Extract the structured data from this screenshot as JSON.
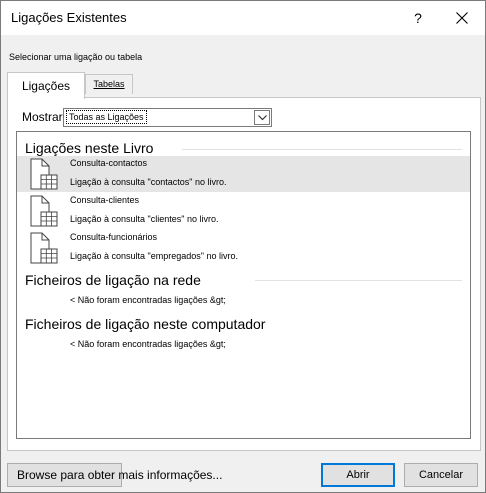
{
  "window": {
    "title": "Ligações Existentes",
    "help_label": "?"
  },
  "subtitle": "Selecionar uma ligação ou tabela",
  "tabs": [
    {
      "label": "Ligações",
      "active": true
    },
    {
      "label": "Tabelas",
      "active": false
    }
  ],
  "show": {
    "label": "Mostrar",
    "selected": "Todas as Ligações"
  },
  "sections": [
    {
      "header": "Ligações neste Livro",
      "items": [
        {
          "name": "Consulta-contactos",
          "description": "Ligação à consulta \"contactos\" no livro.",
          "selected": true
        },
        {
          "name": "Consulta-clientes",
          "description": "Ligação à consulta \"clientes\" no livro.",
          "selected": false
        },
        {
          "name": "Consulta-funcionários",
          "description": "Ligação à consulta \"empregados\" no livro.",
          "selected": false
        }
      ]
    },
    {
      "header": "Ficheiros de ligação na rede",
      "empty_message": "< Não foram encontradas ligações &gt;"
    },
    {
      "header": "Ficheiros de ligação neste computador",
      "empty_message": "< Não foram encontradas ligações &gt;"
    }
  ],
  "buttons": {
    "browse": "Browse para obter mais informações...",
    "open": "Abrir",
    "cancel": "Cancelar"
  },
  "colors": {
    "dialog_bg": "#f0f0f0",
    "selected_row": "#e5e5e5",
    "default_button_border": "#0078d7"
  },
  "icons": [
    "help-icon",
    "close-icon",
    "chevron-down-icon",
    "table-document-icon"
  ]
}
